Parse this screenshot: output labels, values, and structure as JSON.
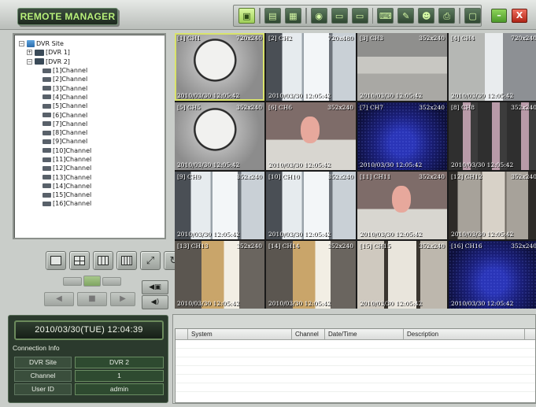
{
  "app": {
    "title": "REMOTE MANAGER"
  },
  "toolbar": {
    "buttons": [
      {
        "name": "live-view",
        "glyph": "▣"
      },
      {
        "name": "playback",
        "glyph": "▤"
      },
      {
        "name": "search",
        "glyph": "▦"
      },
      {
        "name": "setup",
        "glyph": "◉"
      },
      {
        "name": "record",
        "glyph": "▭"
      },
      {
        "name": "export",
        "glyph": "▭"
      },
      {
        "name": "print",
        "glyph": "⌨"
      },
      {
        "name": "config",
        "glyph": "✎"
      },
      {
        "name": "event",
        "glyph": "☻"
      },
      {
        "name": "backup",
        "glyph": "⎙"
      },
      {
        "name": "info",
        "glyph": "▢"
      }
    ],
    "minimize": "–",
    "close": "X"
  },
  "tree": {
    "root": "DVR Site",
    "dvrs": [
      {
        "label": "[DVR 1]",
        "expanded": false
      },
      {
        "label": "[DVR 2]",
        "expanded": true
      }
    ],
    "channels": [
      "[1]Channel",
      "[2]Channel",
      "[3]Channel",
      "[4]Channel",
      "[5]Channel",
      "[6]Channel",
      "[7]Channel",
      "[8]Channel",
      "[9]Channel",
      "[10]Channel",
      "[11]Channel",
      "[12]Channel",
      "[13]Channel",
      "[14]Channel",
      "[15]Channel",
      "[16]Channel"
    ]
  },
  "clock": "2010/03/30(TUE) 12:04:39",
  "connection": {
    "title": "Connection Info",
    "rows": [
      {
        "key": "DVR Site",
        "value": "DVR 2"
      },
      {
        "key": "Channel",
        "value": "1"
      },
      {
        "key": "User ID",
        "value": "admin"
      }
    ]
  },
  "cameras": [
    {
      "label": "[1] CH1",
      "res": "720x240",
      "ts": "2010/03/30 12:05:42",
      "scene": "clock"
    },
    {
      "label": "[2] CH2",
      "res": "720x480",
      "ts": "2010/03/30 12:05:42",
      "scene": "window"
    },
    {
      "label": "[3] CH3",
      "res": "352x240",
      "ts": "2010/03/30 12:05:42",
      "scene": "boxes"
    },
    {
      "label": "[4] CH4",
      "res": "720x240",
      "ts": "2010/03/30 12:05:42",
      "scene": "office"
    },
    {
      "label": "[5] CH5",
      "res": "352x240",
      "ts": "2010/03/30 12:05:42",
      "scene": "clock"
    },
    {
      "label": "[6] CH6",
      "res": "352x240",
      "ts": "2010/03/30 12:05:42",
      "scene": "doll"
    },
    {
      "label": "[7] CH7",
      "res": "352x240",
      "ts": "2010/03/30 12:05:42",
      "scene": "night"
    },
    {
      "label": "[8] CH8",
      "res": "352x240",
      "ts": "2010/03/30 12:05:42",
      "scene": "multi"
    },
    {
      "label": "[9] CH9",
      "res": "352x240",
      "ts": "2010/03/30 12:05:42",
      "scene": "window"
    },
    {
      "label": "[10] CH10",
      "res": "352x240",
      "ts": "2010/03/30 12:05:42",
      "scene": "window"
    },
    {
      "label": "[11] CH11",
      "res": "352x240",
      "ts": "2010/03/30 12:05:42",
      "scene": "doll"
    },
    {
      "label": "[12] CH12",
      "res": "352x240",
      "ts": "2010/03/30 12:05:42",
      "scene": "door"
    },
    {
      "label": "[13] CH13",
      "res": "352x240",
      "ts": "2010/03/30 12:05:42",
      "scene": "doorlit"
    },
    {
      "label": "[14] CH14",
      "res": "352x240",
      "ts": "2010/03/30 12:05:42",
      "scene": "doorlit"
    },
    {
      "label": "[15] CH15",
      "res": "352x240",
      "ts": "2010/03/30 12:05:42",
      "scene": "door2"
    },
    {
      "label": "[16] CH16",
      "res": "352x240",
      "ts": "2010/03/30 12:05:42",
      "scene": "night"
    }
  ],
  "log": {
    "columns": [
      "System",
      "Channel",
      "Date/Time",
      "Description"
    ]
  },
  "colors": {
    "accent": "#b8f07a",
    "panel_dark": "#2b3a2d",
    "selection": "#d9e36a"
  }
}
